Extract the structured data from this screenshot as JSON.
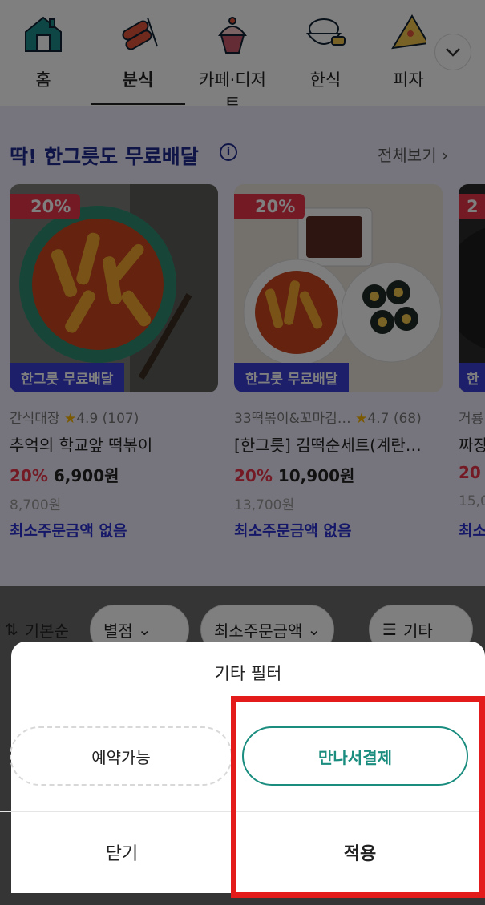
{
  "categories": [
    {
      "label": "홈",
      "icon": "home-icon"
    },
    {
      "label": "분식",
      "icon": "tteokbokki-icon",
      "active": true
    },
    {
      "label": "카페·디저트",
      "icon": "cupcake-icon"
    },
    {
      "label": "한식",
      "icon": "rice-bowl-icon"
    },
    {
      "label": "피자",
      "icon": "pizza-icon"
    }
  ],
  "promo": {
    "title": "딱! 한그릇도 무료배달",
    "see_all": "전체보기",
    "cards": [
      {
        "discount": "20%",
        "tag": "한그릇 무료배달",
        "store": "간식대장",
        "rating": "4.9",
        "reviews": "(107)",
        "name": "추억의 학교앞 떡볶이",
        "pct": "20%",
        "price": "6,900원",
        "original_price": "8,700원",
        "min_order": "최소주문금액 없음"
      },
      {
        "discount": "20%",
        "tag": "한그릇 무료배달",
        "store": "33떡볶이&꼬마김…",
        "rating": "4.7",
        "reviews": "(68)",
        "name": "[한그릇] 김떡순세트(계란…",
        "pct": "20%",
        "price": "10,900원",
        "original_price": "13,700원",
        "min_order": "최소주문금액 없음"
      },
      {
        "discount": "2",
        "tag": "한",
        "store": "거룡",
        "name": "짜장",
        "pct": "20",
        "original_price": "15,0",
        "min_order": "최소"
      }
    ]
  },
  "chips": {
    "sort": "기본순",
    "rating": "별점",
    "min_order": "최소주문금액",
    "etc": "기타"
  },
  "sheet": {
    "title": "기타 필터",
    "option_reserve": "예약가능",
    "option_meet_pay": "만나서결제",
    "close": "닫기",
    "apply": "적용"
  },
  "colors": {
    "promo_bg": "#ecebfb",
    "brand_blue": "#2b2fd0",
    "discount_red": "#e8354a",
    "teal": "#1a8d7f",
    "highlight_red": "#e41b1b"
  }
}
